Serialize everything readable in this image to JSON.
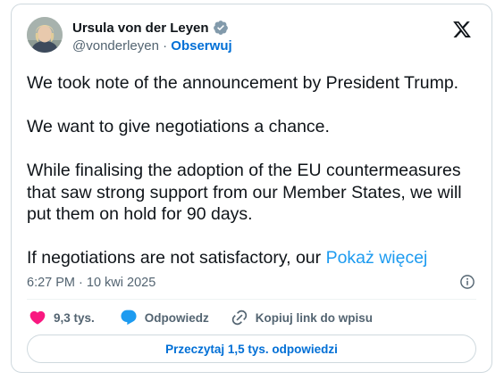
{
  "author": {
    "display_name": "Ursula von der Leyen",
    "handle": "@vonderleyen",
    "separator": " · ",
    "follow_label": "Obserwuj",
    "verified": true
  },
  "tweet": {
    "paragraphs": [
      "We took note of the announcement by President Trump.",
      "We want to give negotiations a chance.",
      "While finalising the adoption of the EU countermeasures that saw strong support from our Member States, we will put them on hold for 90 days.",
      "If negotiations are not satisfactory, our "
    ],
    "show_more_label": "Pokaż więcej",
    "timestamp": "6:27 PM · 10 kwi 2025"
  },
  "actions": {
    "likes": "9,3 tys.",
    "reply_label": "Odpowiedz",
    "copy_link_label": "Kopiuj link do wpisu"
  },
  "replies_button_label": "Przeczytaj 1,5 tys. odpowiedzi",
  "icons": {
    "logo": "x-logo-icon",
    "verified": "verified-badge-icon",
    "info": "info-icon",
    "like": "heart-icon",
    "reply": "speech-bubble-icon",
    "copy_link": "link-icon"
  },
  "colors": {
    "accent": "#1d9bf0",
    "link_blue": "#006fd6",
    "like_pink": "#f91880",
    "text": "#0f1419",
    "secondary_text": "#536471",
    "border": "#cfd9de"
  }
}
